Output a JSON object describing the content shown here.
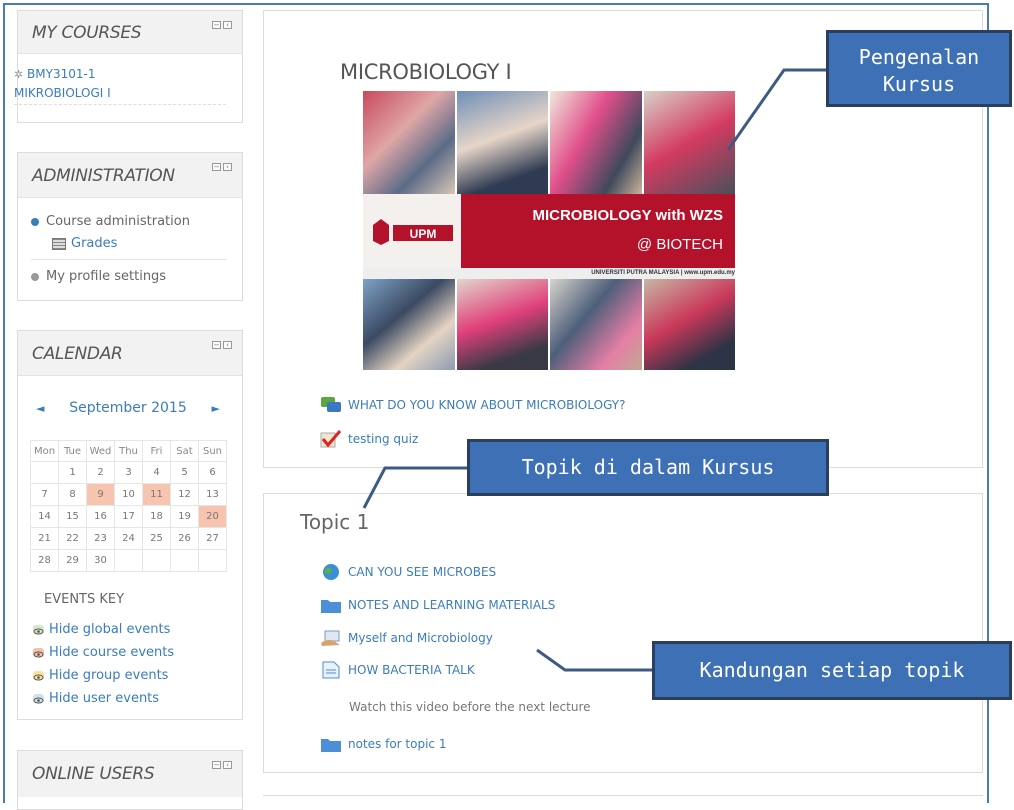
{
  "sidebar": {
    "my_courses": {
      "title": "MY COURSES",
      "course_line1": "BMY3101-1",
      "course_line2": "MIKROBIOLOGI I"
    },
    "administration": {
      "title": "ADMINISTRATION",
      "course_admin": "Course administration",
      "grades": "Grades",
      "profile": "My profile settings"
    },
    "calendar": {
      "title": "CALENDAR",
      "prev": "◄",
      "month": "September 2015",
      "next": "►",
      "weekdays": [
        "Mon",
        "Tue",
        "Wed",
        "Thu",
        "Fri",
        "Sat",
        "Sun"
      ],
      "weeks": [
        [
          "",
          "1",
          "2",
          "3",
          "4",
          "5",
          "6"
        ],
        [
          "7",
          "8",
          "9",
          "10",
          "11",
          "12",
          "13"
        ],
        [
          "14",
          "15",
          "16",
          "17",
          "18",
          "19",
          "20"
        ],
        [
          "21",
          "22",
          "23",
          "24",
          "25",
          "26",
          "27"
        ],
        [
          "28",
          "29",
          "30",
          "",
          "",
          "",
          ""
        ]
      ],
      "highlighted_days": [
        "9",
        "11",
        "20"
      ],
      "events_key": "EVENTS KEY",
      "events": [
        "Hide global events",
        "Hide course events",
        "Hide group events",
        "Hide user events"
      ],
      "event_colors": [
        "#d3e9c9",
        "#f5c0a8",
        "#f7e4a3",
        "#d4e1e8"
      ]
    },
    "online_users": {
      "title": "ONLINE USERS"
    }
  },
  "main": {
    "course_title": "MICROBIOLOGY I",
    "banner": {
      "headline": "MICROBIOLOGY with WZS",
      "sub": "@ BIOTECH",
      "logo_text": "UPM",
      "footer": "UNIVERSITI PUTRA MALAYSIA  |  www.upm.edu.my"
    },
    "intro_activities": [
      "WHAT DO YOU KNOW ABOUT MICROBIOLOGY?",
      "testing quiz"
    ],
    "topic1": {
      "title": "Topic 1",
      "activities": [
        "CAN YOU SEE MICROBES",
        "NOTES AND LEARNING MATERIALS",
        "Myself and Microbiology",
        "HOW BACTERIA TALK"
      ],
      "note": "Watch this video before the next lecture",
      "last": "notes for topic 1"
    }
  },
  "callouts": {
    "intro_line1": "Pengenalan",
    "intro_line2": "Kursus",
    "topics": "Topik di dalam Kursus",
    "content": "Kandungan setiap topik"
  },
  "colors": {
    "accent": "#3a7cbd",
    "callout_bg": "#3d70b5",
    "callout_border": "#2b3e5c",
    "banner_red": "#b3122a"
  }
}
